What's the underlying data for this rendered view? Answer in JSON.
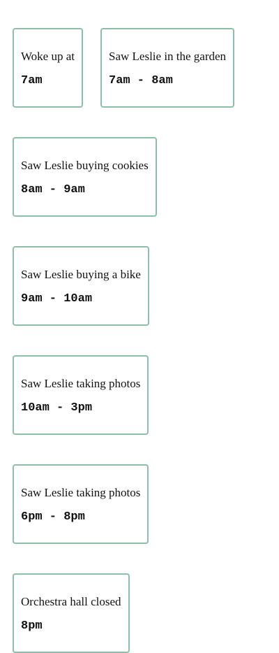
{
  "events": [
    {
      "description": "Woke up at",
      "time": "7am"
    },
    {
      "description": "Saw Leslie in the garden",
      "time": "7am - 8am"
    },
    {
      "description": "Saw Leslie buying cookies",
      "time": "8am - 9am"
    },
    {
      "description": "Saw Leslie buying a bike",
      "time": "9am - 10am"
    },
    {
      "description": "Saw Leslie taking photos",
      "time": "10am - 3pm"
    },
    {
      "description": "Saw Leslie taking photos",
      "time": "6pm - 8pm"
    },
    {
      "description": "Orchestra hall closed",
      "time": "8pm"
    }
  ],
  "colors": {
    "card_border": "#8cbfa8",
    "text": "#111111",
    "background": "#ffffff"
  }
}
